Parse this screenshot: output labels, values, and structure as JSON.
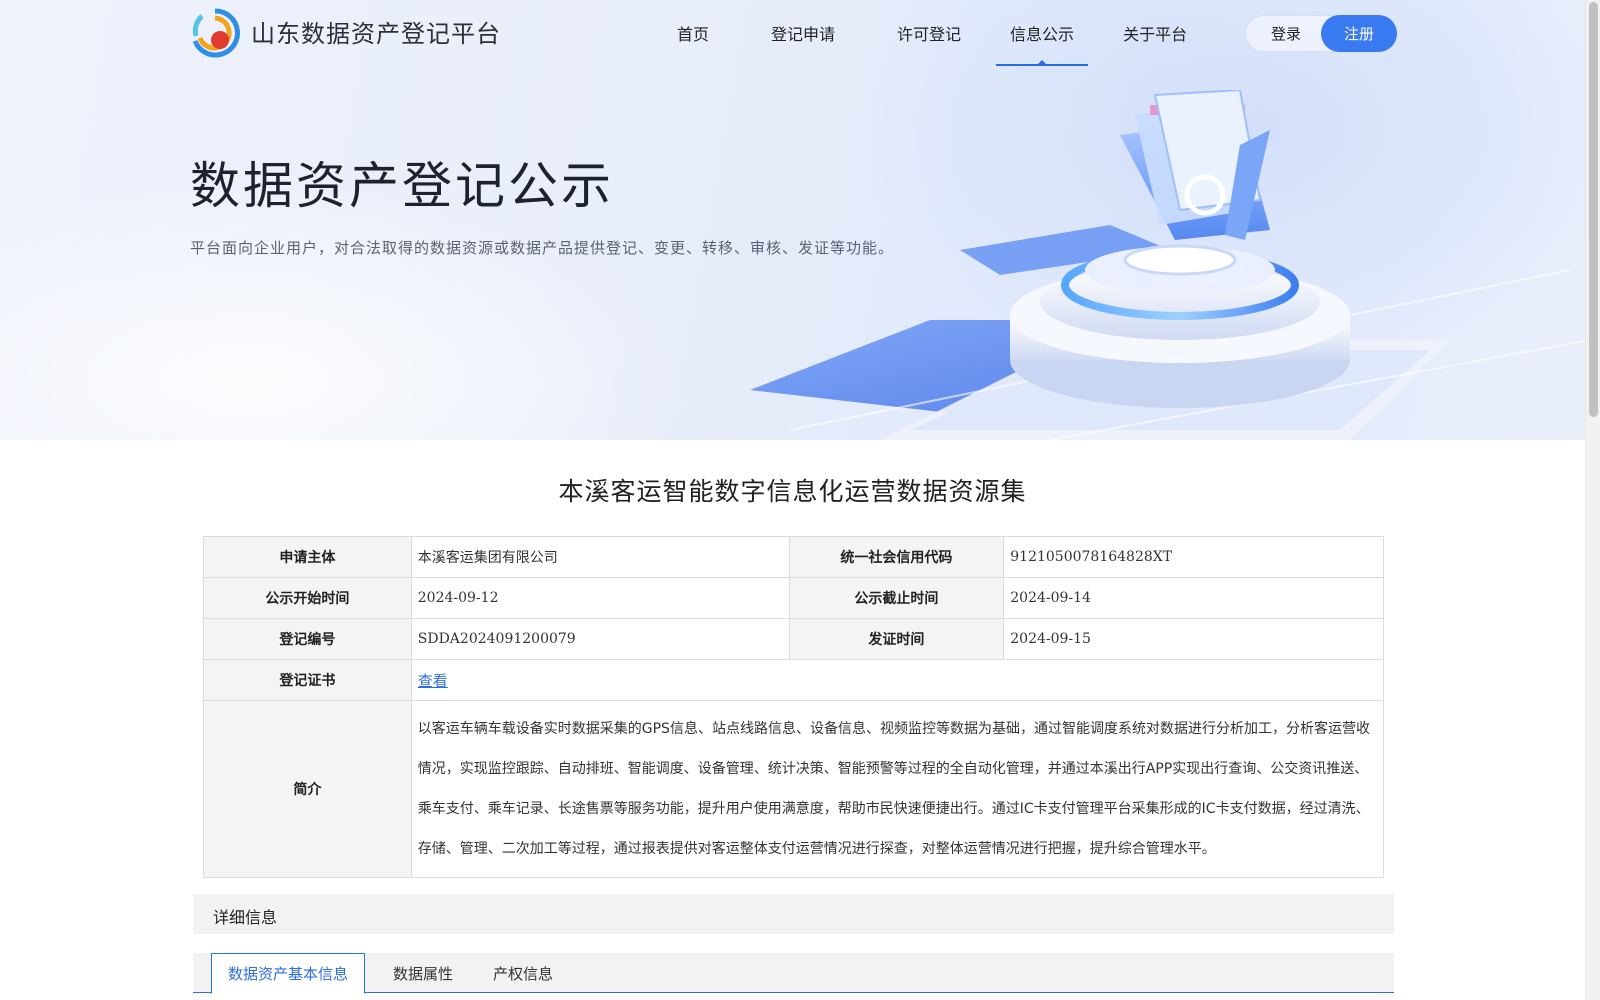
{
  "header": {
    "brand": "山东数据资产登记平台",
    "nav": [
      {
        "label": "首页",
        "active": false
      },
      {
        "label": "登记申请",
        "active": false
      },
      {
        "label": "许可登记",
        "active": false
      },
      {
        "label": "信息公示",
        "active": true
      },
      {
        "label": "关于平台",
        "active": false
      }
    ],
    "login_label": "登录",
    "register_label": "注册"
  },
  "hero": {
    "title": "数据资产登记公示",
    "description": "平台面向企业用户，对合法取得的数据资源或数据产品提供登记、变更、转移、审核、发证等功能。"
  },
  "detail": {
    "title": "本溪客运智能数字信息化运营数据资源集",
    "rows": {
      "applicant_label": "申请主体",
      "applicant_value": "本溪客运集团有限公司",
      "credit_code_label": "统一社会信用代码",
      "credit_code_value": "9121050078164828XT",
      "start_label": "公示开始时间",
      "start_value": "2024-09-12",
      "end_label": "公示截止时间",
      "end_value": "2024-09-14",
      "reg_no_label": "登记编号",
      "reg_no_value": "SDDA2024091200079",
      "issue_label": "发证时间",
      "issue_value": "2024-09-15",
      "cert_label": "登记证书",
      "cert_link": "查看",
      "intro_label": "简介",
      "intro_value": "以客运车辆车载设备实时数据采集的GPS信息、站点线路信息、设备信息、视频监控等数据为基础，通过智能调度系统对数据进行分析加工，分析客运营收情况，实现监控跟踪、自动排班、智能调度、设备管理、统计决策、智能预警等过程的全自动化管理，并通过本溪出行APP实现出行查询、公交资讯推送、乘车支付、乘车记录、长途售票等服务功能，提升用户使用满意度，帮助市民快速便捷出行。通过IC卡支付管理平台采集形成的IC卡支付数据，经过清洗、存储、管理、二次加工等过程，通过报表提供对客运整体支付运营情况进行探查，对整体运营情况进行把握，提升综合管理水平。"
    }
  },
  "section": {
    "title": "详细信息",
    "tabs": [
      {
        "label": "数据资产基本信息",
        "active": true
      },
      {
        "label": "数据属性",
        "active": false
      },
      {
        "label": "产权信息",
        "active": false
      }
    ]
  },
  "colors": {
    "accent": "#2b6de6",
    "register_bg": "#3a7af0",
    "label_bg": "#f4f4f4"
  }
}
